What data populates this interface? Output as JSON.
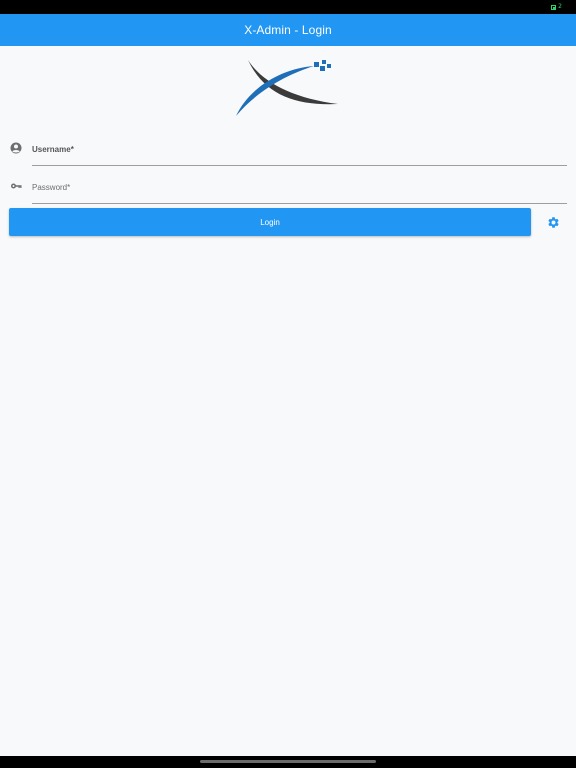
{
  "status_bar": {
    "battery_text": "2",
    "battery_color": "#33d16b"
  },
  "app_bar": {
    "title": "X-Admin - Login",
    "color": "#2196f3"
  },
  "logo": {
    "icon": "x-logo-icon"
  },
  "form": {
    "username": {
      "placeholder": "Username*",
      "value": "",
      "icon": "account-circle-icon"
    },
    "password": {
      "placeholder": "Password*",
      "value": "",
      "icon": "key-icon"
    },
    "login_label": "Login",
    "settings_icon": "gear-icon"
  }
}
